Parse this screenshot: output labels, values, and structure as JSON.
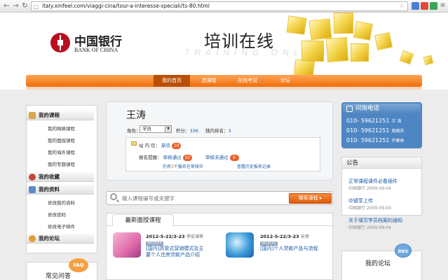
{
  "browser": {
    "url": "italy.xmfeel.com/viaggi-cina/tour-a-interesse-speciali/ts-80.html",
    "back_icon": "arrow-left-icon",
    "forward_icon": "arrow-right-icon",
    "reload_icon": "reload-icon",
    "star_icon": "star-icon"
  },
  "header": {
    "bank_name_cn": "中国银行",
    "bank_name_en": "BANK OF CHINA",
    "title_cn": "培训在线",
    "title_en": "TRAINING ONLINE"
  },
  "nav": {
    "items": [
      "我的首页",
      "选课程",
      "在线考试",
      "论坛"
    ],
    "active_index": 0
  },
  "sidebar": {
    "sections": [
      {
        "title": "我的课程",
        "items": [
          "我的网络课程",
          "我的面授课程",
          "我的海外课程",
          "我的专题课程"
        ]
      },
      {
        "title": "我的收藏",
        "items": []
      },
      {
        "title": "我的资料",
        "items": [
          "修改我的资料",
          "修改密码",
          "修改电子邮件"
        ]
      },
      {
        "title": "我的论坛",
        "items": []
      }
    ],
    "faq_label": "常见问答",
    "faq_badge": "FAQ"
  },
  "user": {
    "name": "王涛",
    "role_label": "角色：",
    "role_value": "学员",
    "points_label": "积分：",
    "points_value": "336",
    "rank_label": "辖内排名：",
    "rank_value": "3"
  },
  "messages": {
    "inbox_label": "站 内 信：",
    "inbox_link": "新信",
    "inbox_count": "10",
    "enroll_label": "报名提醒：",
    "approved_link": "审核通过",
    "approved_count": "10",
    "pending_link": "审核未通过",
    "pending_count": "6",
    "pending_note_pre": "仍有",
    "pending_note_num": "3",
    "pending_note_post": "个报名在审核中",
    "history_link": "查看历史报名记录"
  },
  "search": {
    "placeholder": "输入课程编号或关键字",
    "button_label": "搜索课程 ▸"
  },
  "courses": {
    "tab_label": "最新面授课程",
    "items": [
      {
        "date": "2012-5-22/3-23",
        "teacher": "李宏涛等",
        "code": "W53055",
        "title": "[国内]高管式营销模式及主要个人住房贷款产品介绍"
      },
      {
        "date": "2012-5-22/3-23",
        "teacher": "长帝",
        "code": "W53055",
        "title": "[国内]个人贷款产品与流程"
      }
    ]
  },
  "phone": {
    "heading": "问询电话",
    "rows": [
      {
        "number": "010- 59621251",
        "name": "王  涛"
      },
      {
        "number": "010- 59621251",
        "name": "周国庆"
      },
      {
        "number": "010- 59621251",
        "name": "齐寒林"
      }
    ]
  },
  "notices": {
    "heading": "公告",
    "items": [
      {
        "title": "正常课程课件必备插件",
        "source": "中国银行",
        "date": "2009-09-04"
      },
      {
        "title": "中键享上传",
        "source": "中国银行",
        "date": "2009-09-04"
      },
      {
        "title": "关于填写学员档案的通知",
        "source": "中国银行",
        "date": "2009-09-04"
      }
    ]
  },
  "forum": {
    "label": "我的论坛",
    "badge": "BBS"
  },
  "colors": {
    "nav_orange": "#f06e0c",
    "nav_active": "#b94f07",
    "link_blue": "#1a5ba6",
    "phone_blue": "#4d86c3",
    "bank_red": "#b8101f"
  }
}
